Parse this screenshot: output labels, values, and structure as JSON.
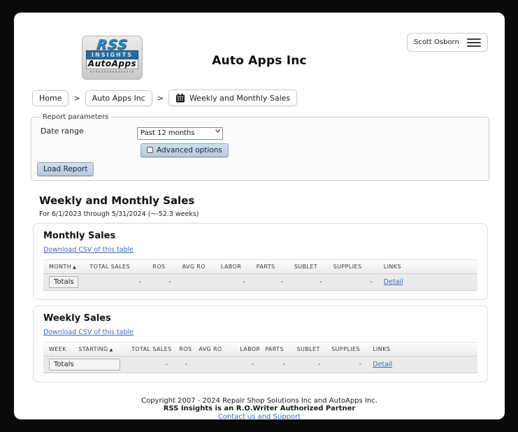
{
  "colors": {
    "link": "#3a6cb5",
    "button-face-top": "#d3deea",
    "button-face-bottom": "#b9c9db",
    "button-border": "#8ba3c0"
  },
  "header": {
    "app_title": "Auto Apps Inc",
    "user_menu": {
      "name": "Scott Osborn",
      "icon": "hamburger-menu"
    },
    "logo": {
      "rss": "RSS",
      "insights": "INSIGHTS",
      "autoapps": "AutoApps"
    }
  },
  "breadcrumb": {
    "separator": ">",
    "items": [
      {
        "label": "Home"
      },
      {
        "label": "Auto Apps Inc"
      },
      {
        "label": "Weekly and Monthly Sales",
        "icon": "calendar"
      }
    ]
  },
  "report_parameters": {
    "legend": "Report parameters",
    "date_range_label": "Date range",
    "date_range_value": "Past 12 months",
    "advanced_options_label": "Advanced options",
    "advanced_options_checked": false,
    "load_report_label": "Load Report"
  },
  "report": {
    "title": "Weekly and Monthly Sales",
    "subtitle": "For 6/1/2023 through 5/31/2024 (~-52.3 weeks)",
    "sort_indicator": "▲",
    "monthly": {
      "title": "Monthly Sales",
      "download_csv_label": "Download CSV of this table",
      "columns": [
        "MONTH",
        "TOTAL SALES",
        "ROS",
        "AVG RO",
        "LABOR",
        "PARTS",
        "SUBLET",
        "SUPPLIES",
        "LINKS"
      ],
      "sort_index": 0,
      "totals": {
        "label": "Totals",
        "values": [
          "-",
          "-",
          "",
          "-",
          "-",
          "-",
          "-"
        ],
        "link": "Detail"
      }
    },
    "weekly": {
      "title": "Weekly Sales",
      "download_csv_label": "Download CSV of this table",
      "columns": [
        "WEEK",
        "STARTING",
        "TOTAL SALES",
        "ROS",
        "AVG RO",
        "LABOR",
        "PARTS",
        "SUBLET",
        "SUPPLIES",
        "LINKS"
      ],
      "sort_index": 1,
      "totals": {
        "label": "Totals",
        "values": [
          "-",
          "-",
          "",
          "-",
          "-",
          "-",
          "-"
        ],
        "link": "Detail"
      }
    }
  },
  "footer": {
    "copyright": "Copyright 2007 - 2024 Repair Shop Solutions Inc and AutoApps Inc.",
    "partner_line": "RSS Insights is an R.O.Writer Authorized Partner",
    "contact_link": "Contact us and Support"
  }
}
